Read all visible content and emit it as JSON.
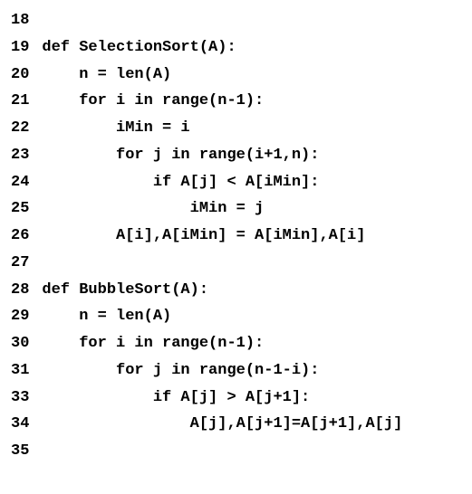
{
  "lines": [
    {
      "n": "18",
      "text": ""
    },
    {
      "n": "19",
      "text": "def SelectionSort(A):"
    },
    {
      "n": "20",
      "text": "    n = len(A)"
    },
    {
      "n": "21",
      "text": "    for i in range(n-1):"
    },
    {
      "n": "22",
      "text": "        iMin = i"
    },
    {
      "n": "23",
      "text": "        for j in range(i+1,n):"
    },
    {
      "n": "24",
      "text": "            if A[j] < A[iMin]:"
    },
    {
      "n": "25",
      "text": "                iMin = j"
    },
    {
      "n": "26",
      "text": "        A[i],A[iMin] = A[iMin],A[i]"
    },
    {
      "n": "27",
      "text": ""
    },
    {
      "n": "28",
      "text": "def BubbleSort(A):"
    },
    {
      "n": "29",
      "text": "    n = len(A)"
    },
    {
      "n": "30",
      "text": "    for i in range(n-1):"
    },
    {
      "n": "31",
      "text": "        for j in range(n-1-i):"
    },
    {
      "n": "33",
      "text": "            if A[j] > A[j+1]:"
    },
    {
      "n": "34",
      "text": "                A[j],A[j+1]=A[j+1],A[j]"
    },
    {
      "n": "35",
      "text": ""
    }
  ]
}
